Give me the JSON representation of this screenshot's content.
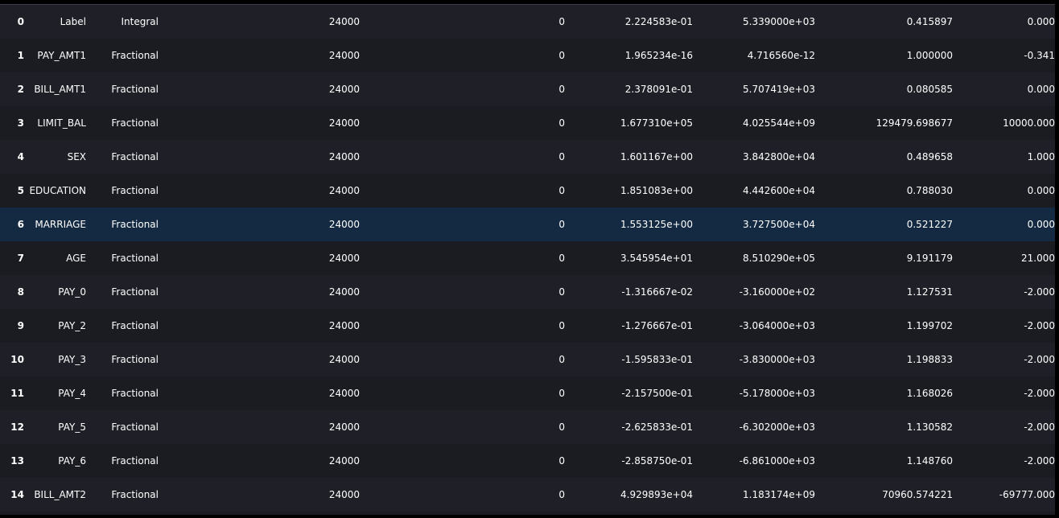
{
  "table": {
    "rows": [
      {
        "index": "0",
        "name": "Label",
        "type": "Integral",
        "count": "24000",
        "missing": "0",
        "mean": "2.224583e-01",
        "sum": "5.339000e+03",
        "std": "0.415897",
        "min": "0.000"
      },
      {
        "index": "1",
        "name": "PAY_AMT1",
        "type": "Fractional",
        "count": "24000",
        "missing": "0",
        "mean": "1.965234e-16",
        "sum": "4.716560e-12",
        "std": "1.000000",
        "min": "-0.341"
      },
      {
        "index": "2",
        "name": "BILL_AMT1",
        "type": "Fractional",
        "count": "24000",
        "missing": "0",
        "mean": "2.378091e-01",
        "sum": "5.707419e+03",
        "std": "0.080585",
        "min": "0.000"
      },
      {
        "index": "3",
        "name": "LIMIT_BAL",
        "type": "Fractional",
        "count": "24000",
        "missing": "0",
        "mean": "1.677310e+05",
        "sum": "4.025544e+09",
        "std": "129479.698677",
        "min": "10000.000"
      },
      {
        "index": "4",
        "name": "SEX",
        "type": "Fractional",
        "count": "24000",
        "missing": "0",
        "mean": "1.601167e+00",
        "sum": "3.842800e+04",
        "std": "0.489658",
        "min": "1.000"
      },
      {
        "index": "5",
        "name": "EDUCATION",
        "type": "Fractional",
        "count": "24000",
        "missing": "0",
        "mean": "1.851083e+00",
        "sum": "4.442600e+04",
        "std": "0.788030",
        "min": "0.000"
      },
      {
        "index": "6",
        "name": "MARRIAGE",
        "type": "Fractional",
        "count": "24000",
        "missing": "0",
        "mean": "1.553125e+00",
        "sum": "3.727500e+04",
        "std": "0.521227",
        "min": "0.000"
      },
      {
        "index": "7",
        "name": "AGE",
        "type": "Fractional",
        "count": "24000",
        "missing": "0",
        "mean": "3.545954e+01",
        "sum": "8.510290e+05",
        "std": "9.191179",
        "min": "21.000"
      },
      {
        "index": "8",
        "name": "PAY_0",
        "type": "Fractional",
        "count": "24000",
        "missing": "0",
        "mean": "-1.316667e-02",
        "sum": "-3.160000e+02",
        "std": "1.127531",
        "min": "-2.000"
      },
      {
        "index": "9",
        "name": "PAY_2",
        "type": "Fractional",
        "count": "24000",
        "missing": "0",
        "mean": "-1.276667e-01",
        "sum": "-3.064000e+03",
        "std": "1.199702",
        "min": "-2.000"
      },
      {
        "index": "10",
        "name": "PAY_3",
        "type": "Fractional",
        "count": "24000",
        "missing": "0",
        "mean": "-1.595833e-01",
        "sum": "-3.830000e+03",
        "std": "1.198833",
        "min": "-2.000"
      },
      {
        "index": "11",
        "name": "PAY_4",
        "type": "Fractional",
        "count": "24000",
        "missing": "0",
        "mean": "-2.157500e-01",
        "sum": "-5.178000e+03",
        "std": "1.168026",
        "min": "-2.000"
      },
      {
        "index": "12",
        "name": "PAY_5",
        "type": "Fractional",
        "count": "24000",
        "missing": "0",
        "mean": "-2.625833e-01",
        "sum": "-6.302000e+03",
        "std": "1.130582",
        "min": "-2.000"
      },
      {
        "index": "13",
        "name": "PAY_6",
        "type": "Fractional",
        "count": "24000",
        "missing": "0",
        "mean": "-2.858750e-01",
        "sum": "-6.861000e+03",
        "std": "1.148760",
        "min": "-2.000"
      },
      {
        "index": "14",
        "name": "BILL_AMT2",
        "type": "Fractional",
        "count": "24000",
        "missing": "0",
        "mean": "4.929893e+04",
        "sum": "1.183174e+09",
        "std": "70960.574221",
        "min": "-69777.000"
      }
    ],
    "hovered_row_index": 6
  },
  "colors": {
    "page_background": "#000000",
    "table_background": "#1b1c22",
    "alt_row_background": "#1f2027",
    "hover_row_background": "#142a42",
    "text": "#ffffff"
  }
}
